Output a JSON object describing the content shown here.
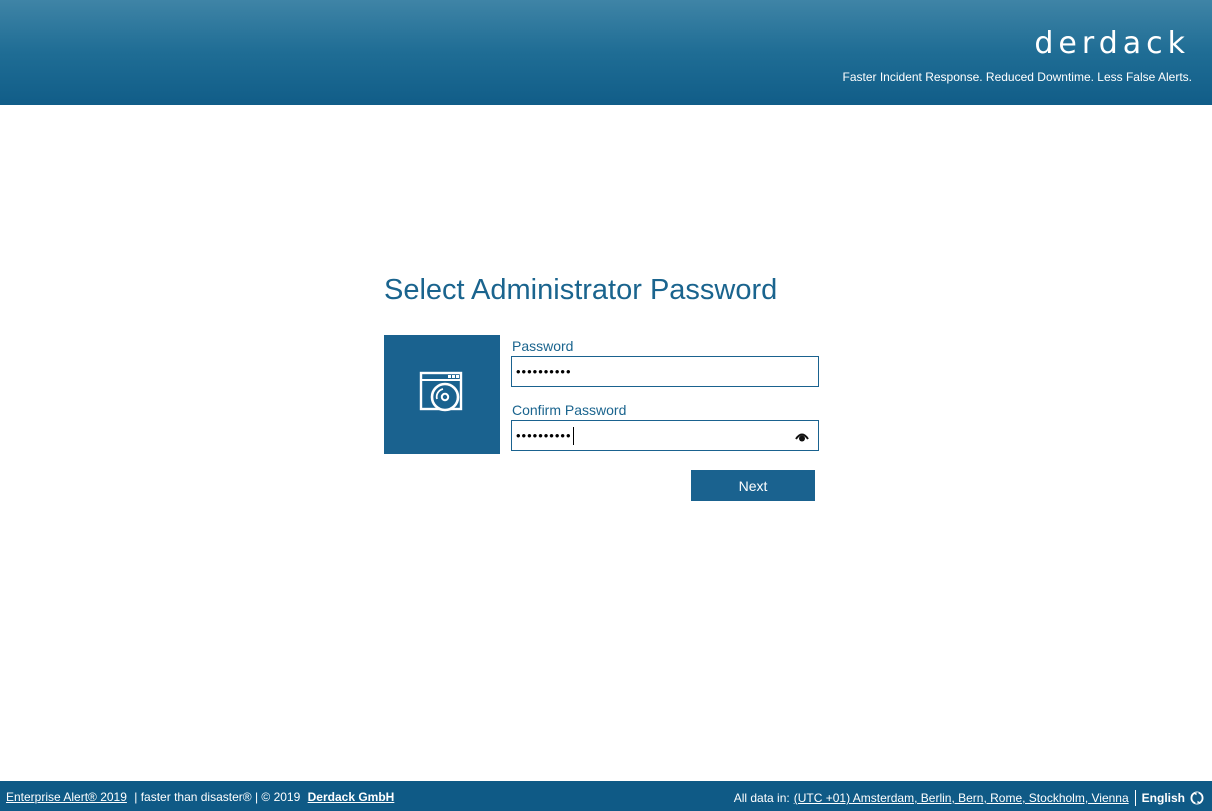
{
  "header": {
    "brand": "Derdack",
    "tagline": "Faster Incident Response. Reduced Downtime. Less False Alerts."
  },
  "main": {
    "title": "Select Administrator Password",
    "app_tile_icon": "installer-disc-icon",
    "password_label": "Password",
    "password_value": "••••••••••",
    "confirm_label": "Confirm Password",
    "confirm_value": "••••••••••",
    "reveal_icon": "eye-icon",
    "next_label": "Next"
  },
  "footer": {
    "product_link": "Enterprise Alert® 2019",
    "slogan": "| faster than disaster® | © 2019",
    "company_link": "Derdack GmbH",
    "timezone_prefix": "All data in:",
    "timezone_link": "(UTC +01) Amsterdam, Berlin, Bern, Rome, Stockholm, Vienna",
    "language": "English",
    "language_icon": "globe-icon"
  },
  "colors": {
    "accent": "#1a628f",
    "header_top": "#3f84a6",
    "footer": "#0f5a86"
  }
}
